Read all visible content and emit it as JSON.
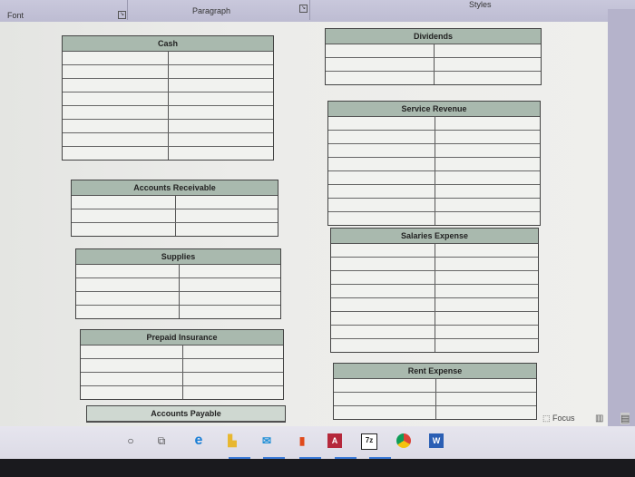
{
  "ribbon": {
    "groups": [
      {
        "label": "Font"
      },
      {
        "label": "Paragraph"
      },
      {
        "label": "Styles"
      }
    ]
  },
  "accounts": {
    "cash": "Cash",
    "accounts_receivable": "Accounts Receivable",
    "supplies": "Supplies",
    "prepaid_insurance": "Prepaid Insurance",
    "accounts_payable": "Accounts Payable",
    "dividends": "Dividends",
    "service_revenue": "Service Revenue",
    "salaries_expense": "Salaries Expense",
    "rent_expense": "Rent Expense"
  },
  "statusbar": {
    "focus_label": "Focus"
  },
  "taskbar": {
    "icons": [
      "search-icon",
      "task-view-icon",
      "edge-icon",
      "file-explorer-icon",
      "mail-icon",
      "office-icon",
      "access-icon",
      "7zip-icon",
      "chrome-icon",
      "word-icon"
    ],
    "sevenzip_label": "7z"
  },
  "colors": {
    "account_header": "#a9b9ae",
    "ribbon": "#c4c3d8",
    "taskbar": "#e2e1ea"
  }
}
